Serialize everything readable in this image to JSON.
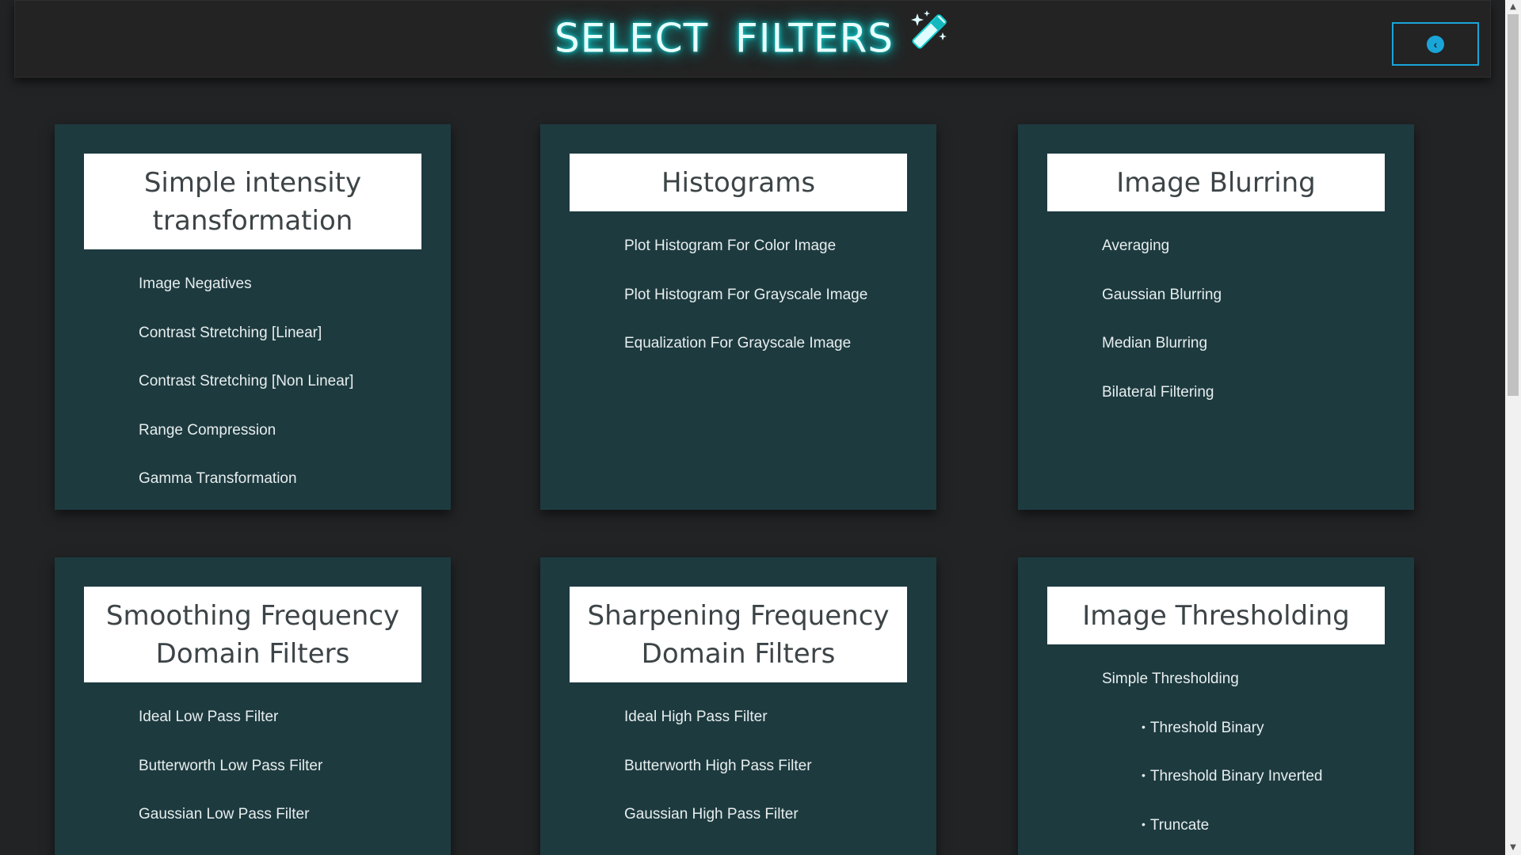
{
  "header": {
    "title": "SELECT  FILTERS",
    "back_icon": "chevron-left-circle-icon"
  },
  "cards": [
    {
      "title": "Simple intensity transformation",
      "items": [
        "Image Negatives",
        "Contrast Stretching [Linear]",
        "Contrast Stretching [Non Linear]",
        "Range Compression",
        "Gamma Transformation"
      ]
    },
    {
      "title": "Histograms",
      "items": [
        "Plot Histogram For Color Image",
        "Plot Histogram For Grayscale Image",
        "Equalization For Grayscale Image"
      ]
    },
    {
      "title": "Image Blurring",
      "items": [
        "Averaging",
        "Gaussian Blurring",
        "Median Blurring",
        "Bilateral Filtering"
      ]
    },
    {
      "title": "Smoothing Frequency Domain Filters",
      "items": [
        "Ideal Low Pass Filter",
        "Butterworth Low Pass Filter",
        "Gaussian Low Pass Filter"
      ]
    },
    {
      "title": "Sharpening Frequency Domain Filters",
      "items": [
        "Ideal High Pass Filter",
        "Butterworth High Pass Filter",
        "Gaussian High Pass Filter"
      ]
    },
    {
      "title": "Image Thresholding",
      "items": [
        "Simple Thresholding",
        "Threshold Binary",
        "Threshold Binary Inverted",
        "Truncate"
      ]
    }
  ],
  "colors": {
    "accent": "#1aa5d8",
    "card_bg": "#1d3a3f",
    "page_bg": "#222325",
    "glow": "#10dede"
  }
}
